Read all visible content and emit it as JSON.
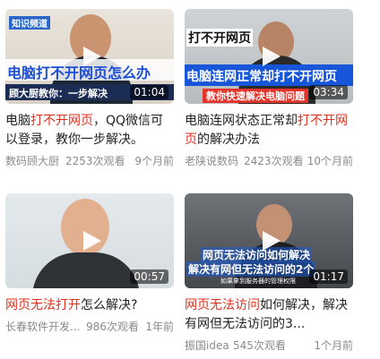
{
  "videos": [
    {
      "title_pre": "电脑",
      "title_hl": "打不开网页",
      "title_post": "，QQ微信可以登录，教你一步解决。",
      "source": "数码顾大厨",
      "views": "2253次观看",
      "time": "9个月前",
      "duration": "01:04",
      "overlay": {
        "top": "知识频道",
        "main": "电脑打不开网页怎么办",
        "bottom": "顾大厨教你：一步解决"
      }
    },
    {
      "title_pre": "电脑连网状态正常却",
      "title_hl": "打不开网页",
      "title_post": "的解决办法",
      "source": "老陕说数码",
      "views": "2423次观看",
      "time": "10个月前",
      "duration": "03:34",
      "overlay": {
        "top": "打不开网页",
        "main": "电脑连网正常却打不开网页",
        "bottom": "教你快速解决电脑问题"
      }
    },
    {
      "title_pre": "",
      "title_hl": "网页无法打开",
      "title_post": "怎么解决?",
      "source": "长春软件开发...",
      "views": "986次观看",
      "time": "1年前",
      "duration": "00:57"
    },
    {
      "title_pre": "",
      "title_hl": "网页无法访问",
      "title_post": "如何解决，解决有网但无法访问的3...",
      "source": "振国idea",
      "views": "545次观看",
      "time": "1个月前",
      "duration": "01:17",
      "overlay": {
        "line1": "网页无法访问如何解决",
        "line2": "解决有网但无法访问的2个",
        "small": "如果拿到服务器的管理权限"
      }
    }
  ],
  "colors": {
    "highlight": "#e0311f",
    "meta": "#8a8a8a",
    "title": "#222222"
  }
}
